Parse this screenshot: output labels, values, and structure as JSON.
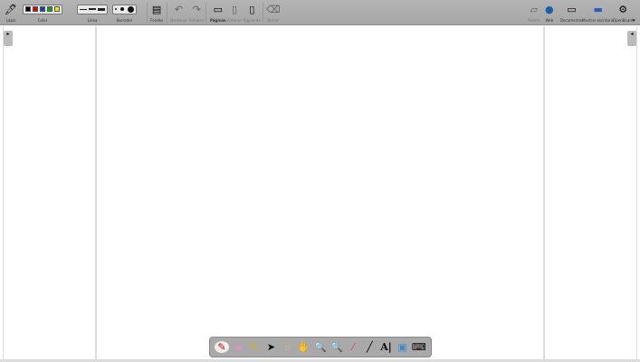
{
  "toolbar": {
    "pen": "Lápiz",
    "color": "Color",
    "line": "Línea",
    "eraser": "Borrador",
    "backgrounds": "Fondos",
    "undo": "Deshacer",
    "redo": "Rehacer",
    "pages": "Páginas",
    "previous": "Anterior",
    "next": "Siguiente",
    "clear": "Borrar",
    "board": "Pizarra",
    "web": "Web",
    "documents": "Documentos",
    "show_desktop": "Mostrar escritorio",
    "openboard": "OpenBoard",
    "colors": [
      "#000000",
      "#e00000",
      "#0050a0",
      "#10a020",
      "#f0e020"
    ]
  },
  "dock": {
    "tools": [
      "pen",
      "eraser",
      "marker",
      "selector",
      "interact",
      "hand",
      "zoom-in",
      "zoom-out",
      "laser-pointer",
      "line",
      "text",
      "capture",
      "virtual-keyboard"
    ]
  }
}
